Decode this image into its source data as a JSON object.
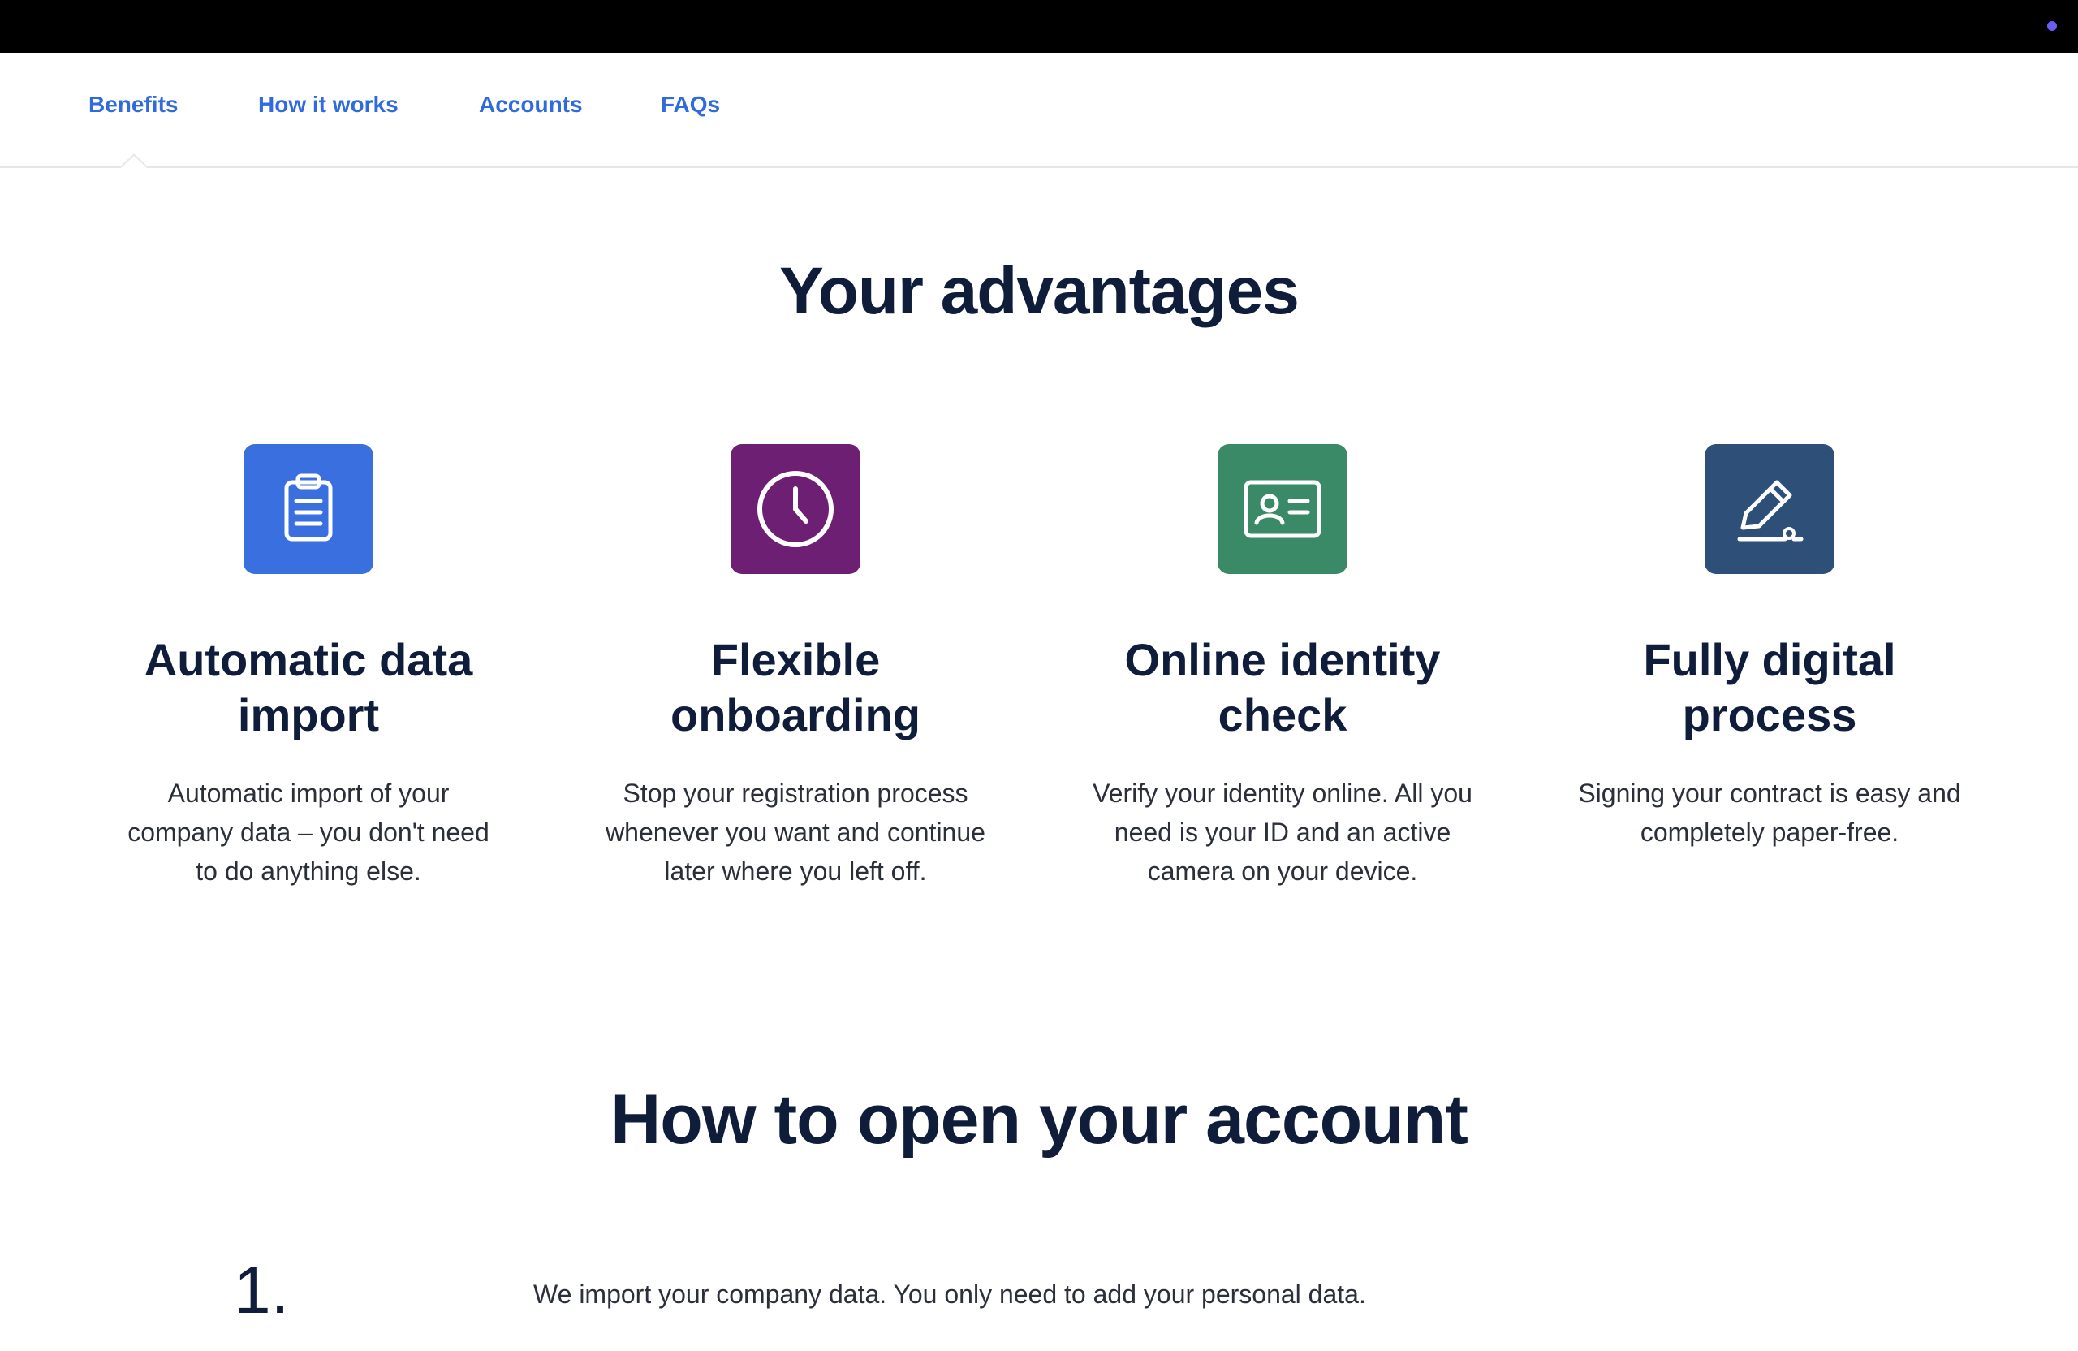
{
  "colors": {
    "topbar": "#000000",
    "accent_dot": "#6b5cf5",
    "nav_link": "#2f6bdc",
    "heading": "#0f1d3b",
    "body_text": "#2a2f3a"
  },
  "nav": {
    "tabs": [
      {
        "label": "Benefits",
        "active": true
      },
      {
        "label": "How it works",
        "active": false
      },
      {
        "label": "Accounts",
        "active": false
      },
      {
        "label": "FAQs",
        "active": false
      }
    ]
  },
  "advantages": {
    "title": "Your advantages",
    "cards": [
      {
        "icon": "clipboard-icon",
        "icon_color": "#3a6fe0",
        "title": "Automatic data import",
        "text": "Automatic import of your company data – you don't need to do anything else."
      },
      {
        "icon": "clock-icon",
        "icon_color": "#6c1f73",
        "title": "Flexible onboarding",
        "text": "Stop your registration process whenever you want and continue later where you left off."
      },
      {
        "icon": "id-card-icon",
        "icon_color": "#3a8a67",
        "title": "Online identity check",
        "text": "Verify your identity online. All you need is your ID and an active camera on your device."
      },
      {
        "icon": "pen-signature-icon",
        "icon_color": "#2e4f77",
        "title": "Fully digital process",
        "text": "Signing your contract is easy and completely paper-free."
      }
    ]
  },
  "how_to": {
    "title": "How to open your account",
    "steps": [
      {
        "number": "1.",
        "text": "We import your company data. You only need to add your personal data."
      }
    ]
  }
}
